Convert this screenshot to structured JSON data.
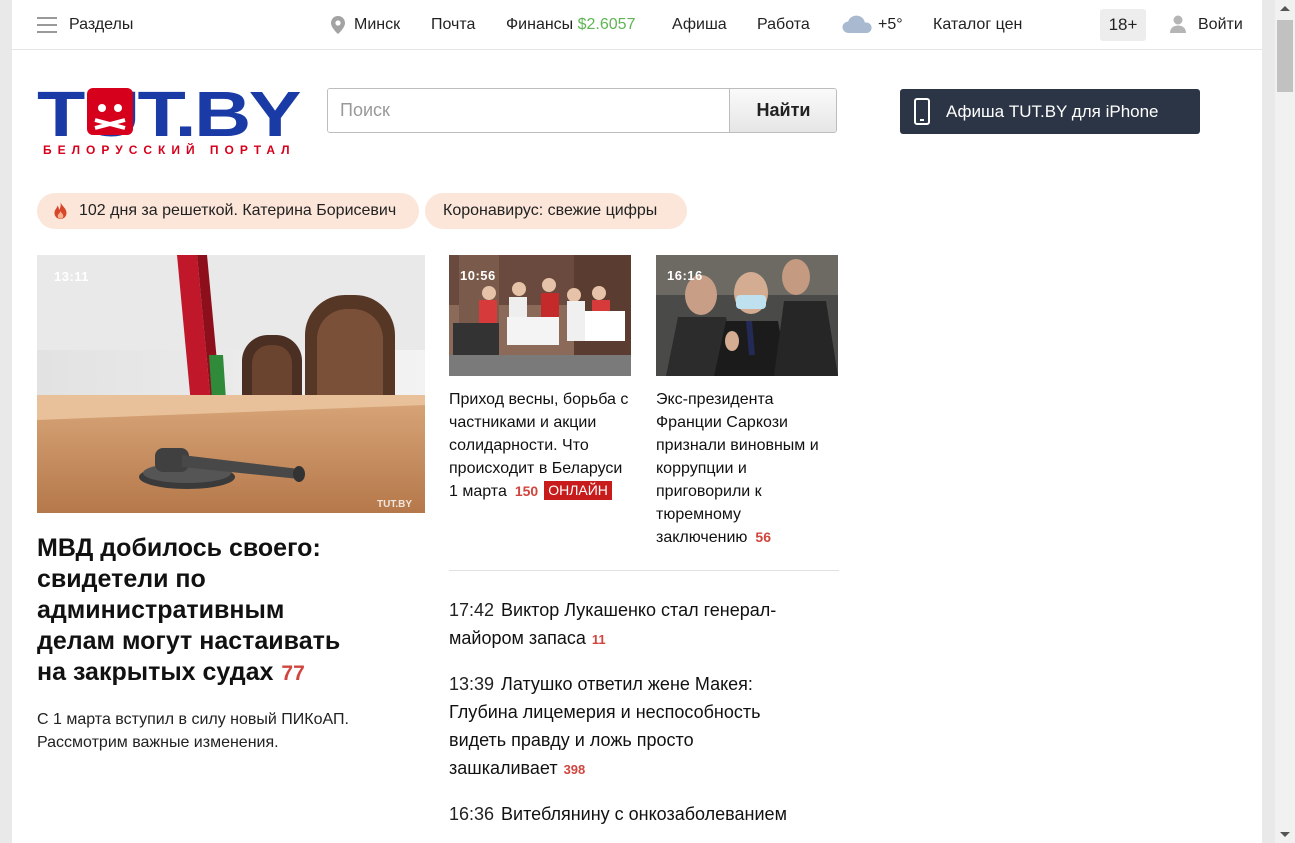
{
  "topbar": {
    "sections_label": "Разделы",
    "city": "Минск",
    "mail": "Почта",
    "finance_label": "Финансы",
    "finance_value": "$2.6057",
    "afisha": "Афиша",
    "work": "Работа",
    "weather": "+5°",
    "catalog": "Каталог цен",
    "age_rating": "18+",
    "login": "Войти"
  },
  "header": {
    "logo_text": "TUT.BY",
    "logo_tagline": "БЕЛОРУССКИЙ ПОРТАЛ",
    "search_placeholder": "Поиск",
    "search_button": "Найти",
    "promo_label": "Афиша TUT.BY для iPhone"
  },
  "tags": [
    {
      "label": "102 дня за решеткой. Катерина Борисевич",
      "icon": "flame-icon"
    },
    {
      "label": "Коронавирус: свежие цифры"
    }
  ],
  "main_story": {
    "time": "13:11",
    "watermark": "TUT.BY",
    "title": "МВД добилось своего: свидетели по административным делам могут настаивать на закрытых судах",
    "comments": "77",
    "subtitle": "С 1 марта вступил в силу новый ПИКоАП. Рассмотрим важные изменения."
  },
  "cards": [
    {
      "time": "10:56",
      "title": "Приход весны, борьба с частниками и акции солидарности. Что происходит в Беларуси 1 марта",
      "comments": "150",
      "badge": "ОНЛАЙН"
    },
    {
      "time": "16:16",
      "title": "Экс-президента Франции Саркози признали виновным и коррупции и приговорили к тюремному заключению",
      "comments": "56"
    }
  ],
  "feed": [
    {
      "time": "17:42",
      "title": "Виктор Лукашенко стал генерал-майором запаса",
      "comments": "11"
    },
    {
      "time": "13:39",
      "title": "Латушко ответил жене Макея: Глубина лицемерия и неспособность видеть правду и ложь просто зашкаливает",
      "comments": "398"
    },
    {
      "time": "16:36",
      "title": "Витеблянину с онкозаболеванием",
      "comments": ""
    }
  ],
  "colors": {
    "accent_red": "#d0453e",
    "logo_blue": "#1a3aa6",
    "logo_red": "#d6001c",
    "finance_green": "#5fb553",
    "tag_bg": "#fbe6d9",
    "promo_bg": "#2c3545",
    "online_red": "#c81c1c"
  }
}
